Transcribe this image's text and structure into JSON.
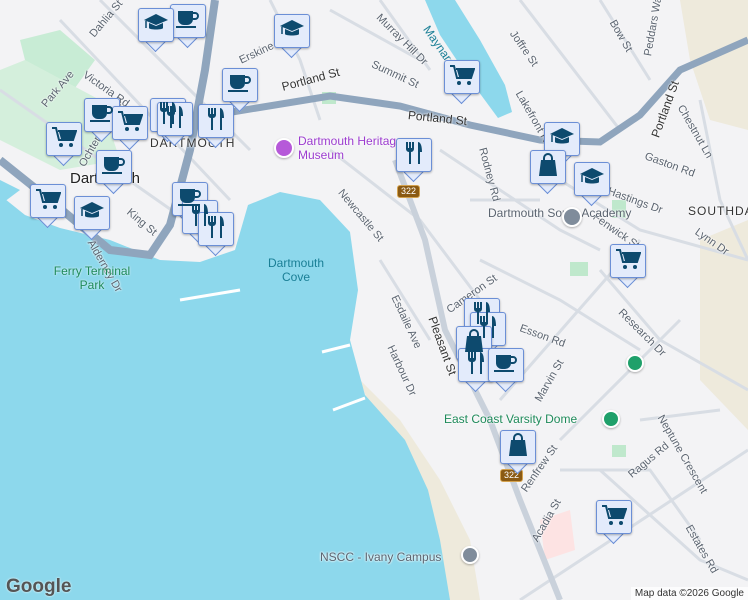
{
  "labels": {
    "streets": [
      "Portland St",
      "Portland St",
      "Portland St",
      "Victoria Rd",
      "Park Ave",
      "Dahlia St",
      "Ochterloney St",
      "King St",
      "Erskine St",
      "Summit St",
      "Murray Hill Dr",
      "Joffre St",
      "Bow St",
      "Peddars Way",
      "Lakefront Rd",
      "Rodney Rd",
      "Newcastle St",
      "Chestnut Ln",
      "Gaston Rd",
      "Hastings Dr",
      "Fenwick St",
      "Lynn Dr",
      "Research Dr",
      "Cameron St",
      "Esson Rd",
      "Esdaile Ave",
      "Harbour Dr",
      "Pleasant St",
      "Marvin St",
      "Renfrew St",
      "Acadia St",
      "Ragus Rd",
      "Neptune Crescent",
      "Estates Rd",
      "Alderney Dr"
    ],
    "neighborhoods": [
      "DARTMOUTH",
      "SOUTHDALE",
      "Dartmouth"
    ],
    "water": [
      "Maynard Lake",
      "Dartmouth Cove"
    ],
    "parks": [
      "Ferry Terminal Park"
    ],
    "pois": [
      "Dartmouth Heritage Museum",
      "Dartmouth South Academy",
      "East Coast Varsity Dome",
      "NSCC - Ivany Campus"
    ],
    "route_shield": "322"
  },
  "colors": {
    "water": "#8dd8ec",
    "park": "#bfe8cc",
    "road_major": "#8fa5bd",
    "land": "#f3f3f5",
    "marker_fill": "#e3ebfb",
    "marker_icon": "#0d4a6e"
  },
  "markers": [
    "cafe",
    "school",
    "cafe",
    "school",
    "shopping-cart",
    "cafe",
    "shopping-cart",
    "restaurant",
    "restaurant",
    "restaurant",
    "cafe",
    "shopping-cart",
    "school",
    "cafe",
    "restaurant",
    "restaurant",
    "shopping-cart",
    "restaurant",
    "school",
    "shopping-bag",
    "school",
    "shopping-cart",
    "restaurant",
    "restaurant",
    "shopping-bag",
    "restaurant",
    "cafe",
    "shopping-bag",
    "shopping-cart"
  ],
  "attribution": {
    "logo": "Google",
    "text": "Map data ©2026 Google"
  }
}
